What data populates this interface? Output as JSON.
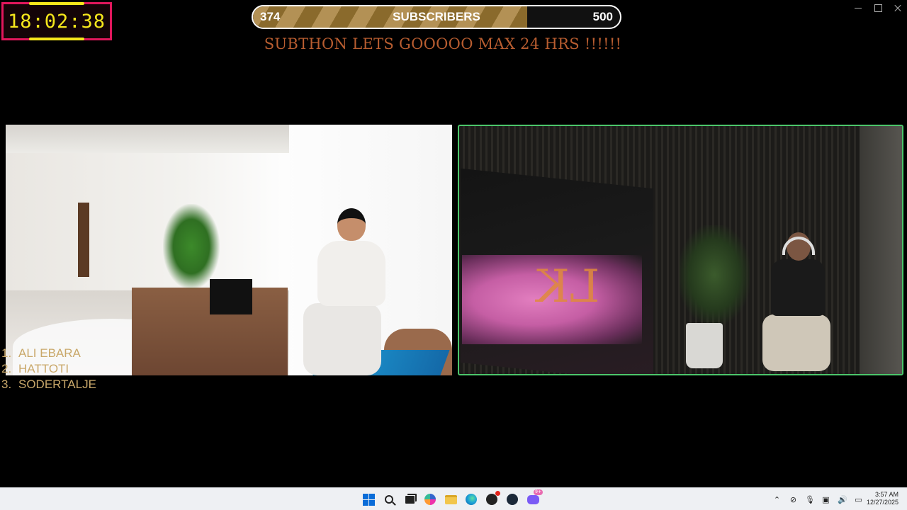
{
  "overlay": {
    "timer": "18:02:38",
    "subscribers": {
      "current": "374",
      "label": "SUBSCRIBERS",
      "goal": "500",
      "progress": 0.748
    },
    "headline": "SUBTHON LETS GOOOOO MAX 24 HRS  !!!!!!",
    "leaderboard": [
      {
        "rank": "1.",
        "name": "ALI EBARA"
      },
      {
        "rank": "2.",
        "name": "HATTOTI"
      },
      {
        "rank": "3.",
        "name": "SODERTALJE"
      }
    ]
  },
  "screen_logo_text": "LK",
  "colors": {
    "timer_border": "#e0175c",
    "timer_text": "#f5e61c",
    "headline": "#b85d30",
    "leaderboard": "#c9a86a",
    "right_cam_border": "#4cc66b"
  },
  "taskbar": {
    "icons": [
      "windows-start-icon",
      "search-icon",
      "task-view-icon",
      "copilot-icon",
      "file-explorer-icon",
      "edge-icon",
      "chatgpt-icon",
      "steam-icon",
      "discord-icon"
    ],
    "discord_badge": "9+",
    "tray": [
      "chevron-up-icon",
      "network-off-icon",
      "microphone-icon",
      "speaker-icon",
      "volume-icon",
      "battery-icon"
    ],
    "time": "3:57 AM",
    "date": "12/27/2025"
  }
}
